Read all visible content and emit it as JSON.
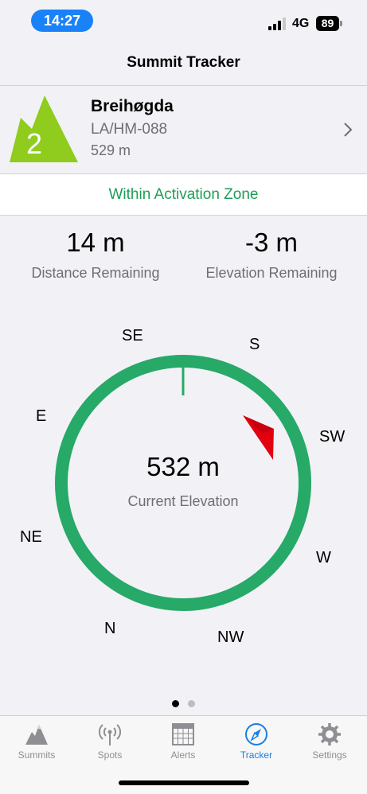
{
  "status_bar": {
    "time": "14:27",
    "network": "4G",
    "battery": "89"
  },
  "nav": {
    "title": "Summit Tracker"
  },
  "summit": {
    "points": "2",
    "name": "Breihøgda",
    "reference": "LA/HM-088",
    "height": "529 m",
    "color": "#8fcc1e"
  },
  "zone": {
    "status": "Within Activation Zone",
    "color": "#1f9d57"
  },
  "stats": {
    "distance_value": "14 m",
    "distance_label": "Distance Remaining",
    "elevation_value": "-3 m",
    "elevation_label": "Elevation Remaining"
  },
  "compass": {
    "labels": {
      "se": "SE",
      "s": "S",
      "sw": "SW",
      "w": "W",
      "nw": "NW",
      "n": "N",
      "ne": "NE",
      "e": "E"
    },
    "current_elevation": "532 m",
    "current_elevation_label": "Current Elevation",
    "ring_color": "#27a968",
    "pointer_color": "#e3000f"
  },
  "pager": {
    "pages": 2,
    "current": 1
  },
  "tabs": [
    {
      "label": "Summits",
      "icon": "mountain-icon",
      "active": false
    },
    {
      "label": "Spots",
      "icon": "antenna-icon",
      "active": false
    },
    {
      "label": "Alerts",
      "icon": "calendar-icon",
      "active": false
    },
    {
      "label": "Tracker",
      "icon": "compass-icon",
      "active": true
    },
    {
      "label": "Settings",
      "icon": "gear-icon",
      "active": false
    }
  ]
}
